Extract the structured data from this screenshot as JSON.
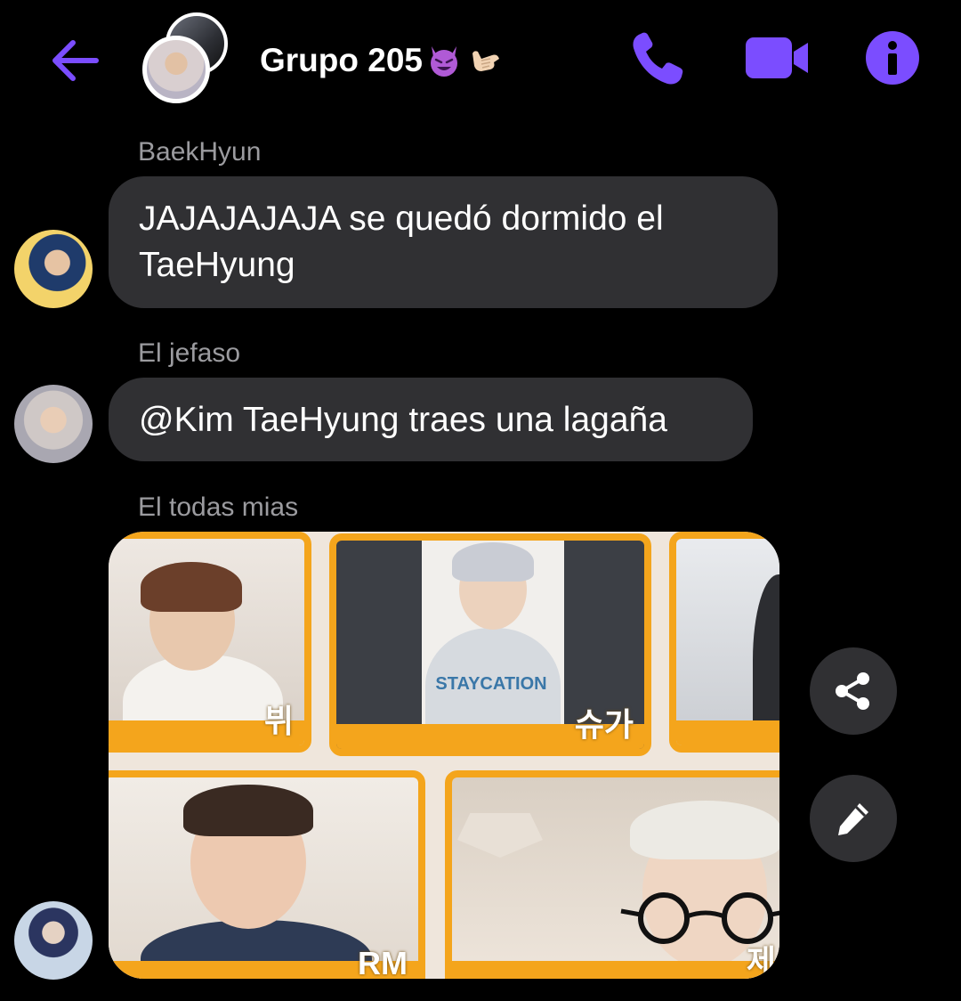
{
  "header": {
    "title": "Grupo 205",
    "title_emojis": [
      "smiling-devil-emoji",
      "call-me-hand-emoji"
    ],
    "back_icon": "arrow-left-icon",
    "actions": [
      "phone-icon",
      "video-camera-icon",
      "info-icon"
    ]
  },
  "messages": [
    {
      "sender": "BaekHyun",
      "text": "JAJAJAJAJA se quedó dormido el TaeHyung"
    },
    {
      "sender": "El jefaso",
      "text": "@Kim TaeHyung traes una lagaña"
    },
    {
      "sender": "El todas mias",
      "attachment": {
        "type": "image",
        "labels": {
          "tile1": "뷔",
          "tile2": "슈가",
          "shirt": "STAYCATION",
          "tile4": "RM",
          "tile5": "제"
        }
      }
    }
  ],
  "side_actions": [
    "share-icon",
    "pencil-icon"
  ],
  "colors": {
    "accent": "#7b4dff",
    "background": "#000000",
    "bubble": "#303033",
    "sender_name": "#9b9b9f",
    "frame_orange": "#f4a51c"
  }
}
